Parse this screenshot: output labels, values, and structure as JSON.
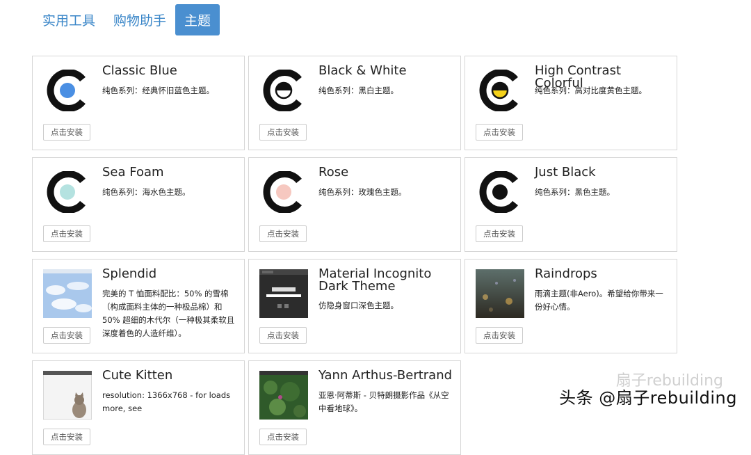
{
  "tabs": [
    {
      "label": "实用工具",
      "active": false
    },
    {
      "label": "购物助手",
      "active": false
    },
    {
      "label": "主题",
      "active": true
    }
  ],
  "install_label": "点击安装",
  "themes": [
    {
      "title": "Classic Blue",
      "desc": "纯色系列：经典怀旧蓝色主题。",
      "icon": "logo-blue-icon",
      "color": "#4a8fe3"
    },
    {
      "title": "Black & White",
      "desc": "纯色系列：黑白主题。",
      "icon": "logo-black-white-icon",
      "color": "#ffffff"
    },
    {
      "title": "High Contrast Colorful",
      "desc": "纯色系列：高对比度黄色主题。",
      "icon": "logo-yellow-icon",
      "color": "#f5d21a"
    },
    {
      "title": "Sea Foam",
      "desc": "纯色系列：海水色主题。",
      "icon": "logo-seafoam-icon",
      "color": "#b4e2e0"
    },
    {
      "title": "Rose",
      "desc": "纯色系列：玫瑰色主题。",
      "icon": "logo-rose-icon",
      "color": "#f6c8c0"
    },
    {
      "title": "Just Black",
      "desc": "纯色系列：黑色主题。",
      "icon": "logo-black-icon",
      "color": "#111111"
    },
    {
      "title": "Splendid",
      "desc": "完美的 T 恤面料配比：50% 的雪棉（构成面料主体的一种极品棉）和 50% 超细的木代尔（一种极其柔软且深度着色的人造纤维）。",
      "icon": "clouds-thumbnail"
    },
    {
      "title": "Material Incognito Dark Theme",
      "desc": "仿隐身窗口深色主题。",
      "icon": "dark-browser-thumbnail"
    },
    {
      "title": "Raindrops",
      "desc": "雨滴主题(非Aero)。希望给你带来一份好心情。",
      "icon": "raindrops-thumbnail"
    },
    {
      "title": "Cute Kitten",
      "desc": "resolution: 1366x768 - for loads more, see",
      "icon": "kitten-thumbnail"
    },
    {
      "title": "Yann Arthus-Bertrand",
      "desc": "亚恩·阿蒂斯 - 贝特朗摄影作品《从空中看地球》。",
      "icon": "aerial-photo-thumbnail"
    }
  ],
  "watermark": "头条 @扇子rebuilding",
  "watermark_ghost": "扇子rebuilding"
}
